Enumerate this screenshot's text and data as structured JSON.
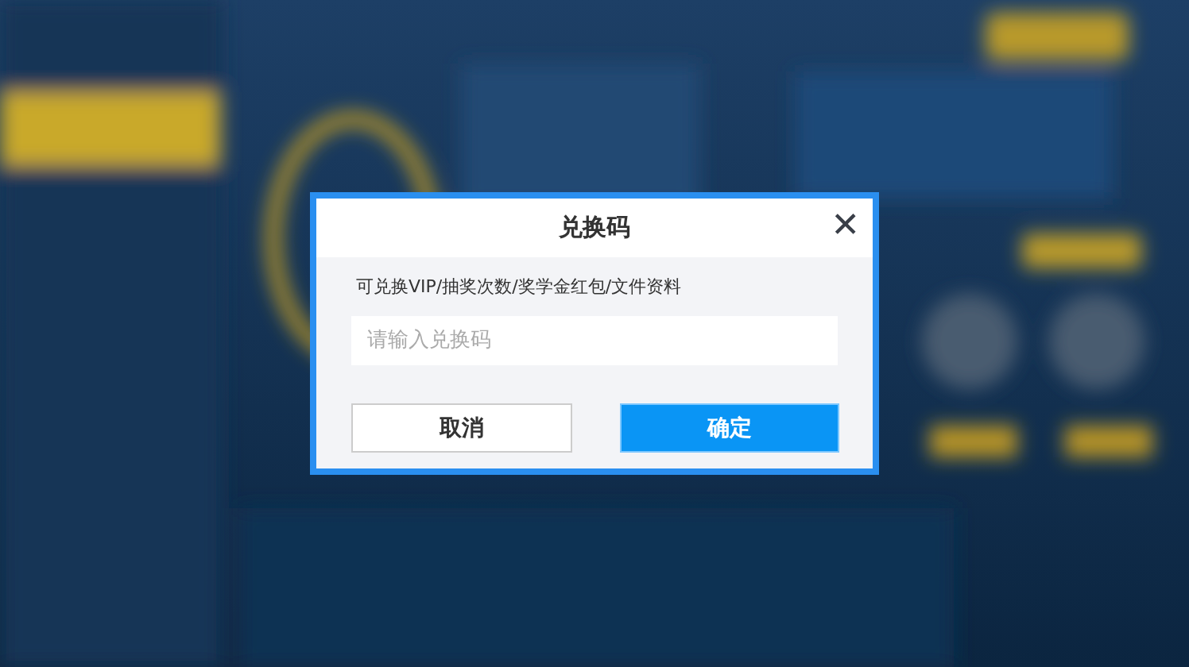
{
  "dialog": {
    "title": "兑换码",
    "close": "✕",
    "description": "可兑换VIP/抽奖次数/奖学金红包/文件资料",
    "code_field": {
      "placeholder": "请输入兑换码"
    },
    "buttons": [
      {
        "label": "取消",
        "kind": "secondary"
      },
      {
        "label": "确定",
        "kind": "primary"
      }
    ]
  }
}
